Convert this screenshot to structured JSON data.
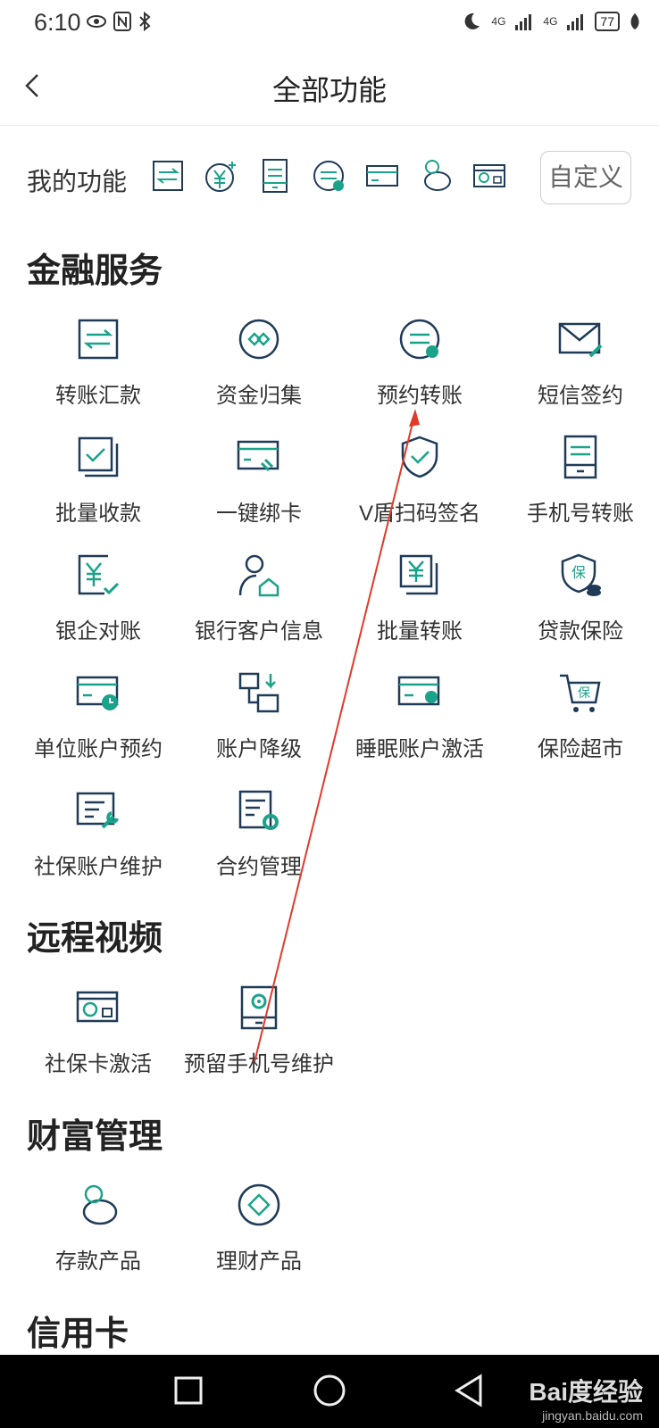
{
  "status_bar": {
    "time": "6:10",
    "signal1": "4G",
    "signal2": "4G",
    "battery": "77"
  },
  "header": {
    "title": "全部功能"
  },
  "my_functions": {
    "label": "我的功能",
    "customize_label": "自定义",
    "icons": [
      "transfer-icon",
      "yuan-add-icon",
      "phone-transfer-icon",
      "scheduled-transfer-icon",
      "card-icon",
      "piggy-bank-icon",
      "social-card-icon"
    ]
  },
  "sections": {
    "finance": {
      "title": "金融服务",
      "items": [
        {
          "label": "转账汇款",
          "icon": "transfer-icon"
        },
        {
          "label": "资金归集",
          "icon": "fund-collect-icon"
        },
        {
          "label": "预约转账",
          "icon": "scheduled-transfer-icon"
        },
        {
          "label": "短信签约",
          "icon": "sms-sign-icon"
        },
        {
          "label": "批量收款",
          "icon": "batch-receive-icon"
        },
        {
          "label": "一键绑卡",
          "icon": "bind-card-icon"
        },
        {
          "label": "V盾扫码签名",
          "icon": "shield-check-icon"
        },
        {
          "label": "手机号转账",
          "icon": "phone-transfer-icon"
        },
        {
          "label": "银企对账",
          "icon": "reconcile-icon"
        },
        {
          "label": "银行客户信息",
          "icon": "customer-info-icon"
        },
        {
          "label": "批量转账",
          "icon": "batch-transfer-icon"
        },
        {
          "label": "贷款保险",
          "icon": "loan-insurance-icon"
        },
        {
          "label": "单位账户预约",
          "icon": "account-appointment-icon"
        },
        {
          "label": "账户降级",
          "icon": "account-downgrade-icon"
        },
        {
          "label": "睡眠账户激活",
          "icon": "dormant-account-icon"
        },
        {
          "label": "保险超市",
          "icon": "insurance-cart-icon"
        },
        {
          "label": "社保账户维护",
          "icon": "social-maintain-icon"
        },
        {
          "label": "合约管理",
          "icon": "contract-manage-icon"
        }
      ]
    },
    "video": {
      "title": "远程视频",
      "items": [
        {
          "label": "社保卡激活",
          "icon": "social-card-icon"
        },
        {
          "label": "预留手机号维护",
          "icon": "phone-settings-icon"
        }
      ]
    },
    "wealth": {
      "title": "财富管理",
      "items": [
        {
          "label": "存款产品",
          "icon": "piggy-bank-icon"
        },
        {
          "label": "理财产品",
          "icon": "diamond-icon"
        }
      ]
    },
    "credit": {
      "title": "信用卡"
    }
  },
  "watermark": {
    "brand": "Bai度经验",
    "url": "jingyan.baidu.com"
  },
  "colors": {
    "navy": "#1f3b57",
    "green": "#1aa38a",
    "arrow": "#e03a2a"
  }
}
